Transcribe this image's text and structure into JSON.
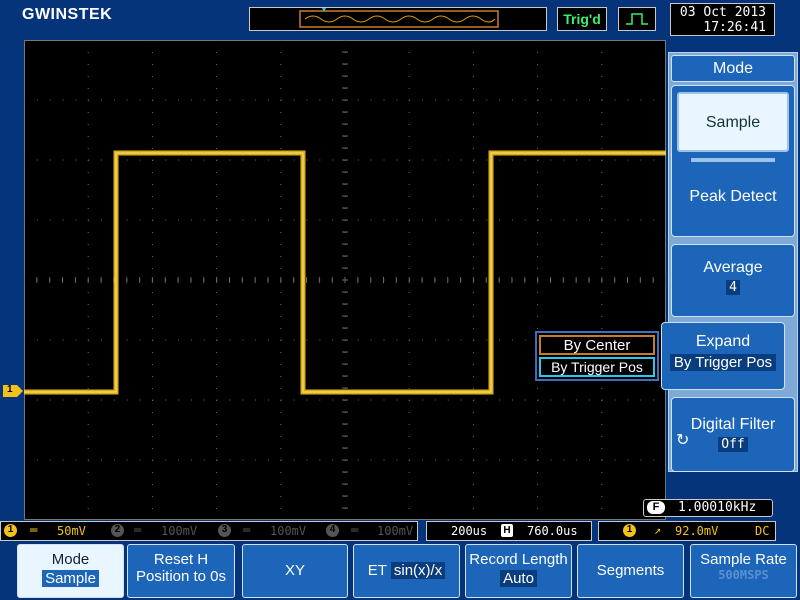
{
  "header": {
    "brand": "GWINSTEK",
    "trigger_status": "Trig'd",
    "date": "03 Oct 2013",
    "time": "17:26:41"
  },
  "waveform": {
    "channel_marker": "1",
    "color": "#f2c21a"
  },
  "side_menu": {
    "title": "Mode",
    "sample_label": "Sample",
    "peak_detect_label": "Peak Detect",
    "average": {
      "label": "Average",
      "value": "4"
    },
    "expand": {
      "label": "Expand",
      "value": "By Trigger Pos"
    },
    "digital_filter": {
      "label": "Digital Filter",
      "value": "Off"
    }
  },
  "expand_popup": {
    "options": [
      "By Center",
      "By Trigger Pos"
    ],
    "selected": "By Trigger Pos"
  },
  "frequency_readout": "1.00010kHz",
  "status_bar": {
    "ch1": {
      "num": "1",
      "scale": "50mV",
      "color": "#f2c21a"
    },
    "ch2": {
      "num": "2",
      "scale": "100mV"
    },
    "ch3": {
      "num": "3",
      "scale": "100mV"
    },
    "ch4": {
      "num": "4",
      "scale": "100mV"
    },
    "timebase": "200us",
    "h_position": "760.0us",
    "trigger_source": "1",
    "trigger_level": "92.0mV",
    "coupling": "DC"
  },
  "bottom_menu": [
    {
      "label": "Mode",
      "value": "Sample"
    },
    {
      "label": "Reset H",
      "value": "Position to 0s"
    },
    {
      "label": "XY",
      "value": ""
    },
    {
      "label": "ET",
      "value": "sin(x)/x"
    },
    {
      "label": "Record Length",
      "value": "Auto"
    },
    {
      "label": "Segments",
      "value": ""
    },
    {
      "label": "Sample Rate",
      "value": "500MSPS"
    }
  ]
}
